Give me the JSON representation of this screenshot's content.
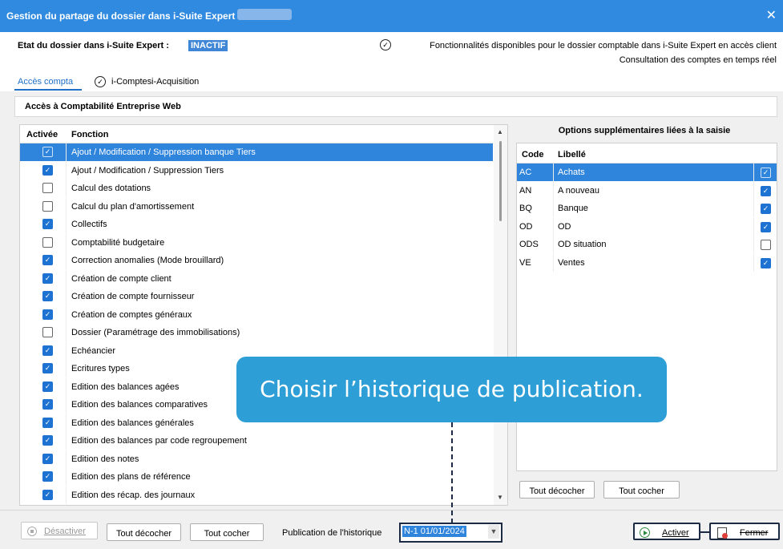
{
  "window": {
    "title": "Gestion du partage du dossier dans i-Suite Expert :",
    "close_icon": "✕"
  },
  "status": {
    "label": "Etat du dossier dans i-Suite Expert :",
    "value": "INACTIF",
    "features_text": "Fonctionnalités disponibles pour le dossier comptable dans i-Suite Expert en accès client",
    "consult_text": "Consultation des comptes en temps réel"
  },
  "tabs": [
    {
      "label": "Accès compta",
      "active": true
    },
    {
      "label": "i-Comptes",
      "active": false
    },
    {
      "label": "i-Acquisition",
      "active": false
    }
  ],
  "section_title": "Accès à Comptabilité Entreprise Web",
  "functions_table": {
    "headers": {
      "activee": "Activée",
      "fonction": "Fonction"
    },
    "rows": [
      {
        "label": "Ajout / Modification / Suppression banque Tiers",
        "checked": true,
        "selected": true
      },
      {
        "label": "Ajout / Modification / Suppression Tiers",
        "checked": true,
        "selected": false
      },
      {
        "label": "Calcul des dotations",
        "checked": false,
        "selected": false
      },
      {
        "label": "Calcul du plan d'amortissement",
        "checked": false,
        "selected": false
      },
      {
        "label": "Collectifs",
        "checked": true,
        "selected": false
      },
      {
        "label": "Comptabilité budgetaire",
        "checked": false,
        "selected": false
      },
      {
        "label": "Correction anomalies (Mode brouillard)",
        "checked": true,
        "selected": false
      },
      {
        "label": "Création de compte client",
        "checked": true,
        "selected": false
      },
      {
        "label": "Création de compte fournisseur",
        "checked": true,
        "selected": false
      },
      {
        "label": "Création de comptes généraux",
        "checked": true,
        "selected": false
      },
      {
        "label": "Dossier (Paramétrage des immobilisations)",
        "checked": false,
        "selected": false
      },
      {
        "label": "Echéancier",
        "checked": true,
        "selected": false
      },
      {
        "label": "Ecritures types",
        "checked": true,
        "selected": false
      },
      {
        "label": "Edition des balances agées",
        "checked": true,
        "selected": false
      },
      {
        "label": "Edition des balances comparatives",
        "checked": true,
        "selected": false
      },
      {
        "label": "Edition des balances générales",
        "checked": true,
        "selected": false
      },
      {
        "label": "Edition des balances par code regroupement",
        "checked": true,
        "selected": false
      },
      {
        "label": "Edition des notes",
        "checked": true,
        "selected": false
      },
      {
        "label": "Edition des plans de référence",
        "checked": true,
        "selected": false
      },
      {
        "label": "Edition des récap. des journaux",
        "checked": true,
        "selected": false
      }
    ]
  },
  "options": {
    "title": "Options supplémentaires liées à la saisie",
    "headers": {
      "code": "Code",
      "libelle": "Libellé"
    },
    "rows": [
      {
        "code": "AC",
        "libelle": "Achats",
        "checked": true,
        "selected": true
      },
      {
        "code": "AN",
        "libelle": "A nouveau",
        "checked": true,
        "selected": false
      },
      {
        "code": "BQ",
        "libelle": "Banque",
        "checked": true,
        "selected": false
      },
      {
        "code": "OD",
        "libelle": "OD",
        "checked": true,
        "selected": false
      },
      {
        "code": "ODS",
        "libelle": "OD situation",
        "checked": false,
        "selected": false
      },
      {
        "code": "VE",
        "libelle": "Ventes",
        "checked": true,
        "selected": false
      }
    ],
    "uncheck_all": "Tout décocher",
    "check_all": "Tout cocher"
  },
  "bottom": {
    "desactiver": "Désactiver",
    "uncheck_all": "Tout décocher",
    "check_all": "Tout cocher",
    "history_label": "Publication de l'historique",
    "history_value": "N-1 01/01/2024",
    "activer": "Activer",
    "fermer": "Fermer"
  },
  "callout": {
    "text": "Choisir l’historique de publication."
  },
  "icons": {
    "check": "✓",
    "scroll_up": "▲",
    "scroll_down": "▼",
    "dropdown_arrow": "▼"
  },
  "colors": {
    "titlebar": "#2f8ae0",
    "selection": "#2f84dc",
    "callout": "#2e9fd6",
    "checkbox_on": "#1e73d2"
  }
}
